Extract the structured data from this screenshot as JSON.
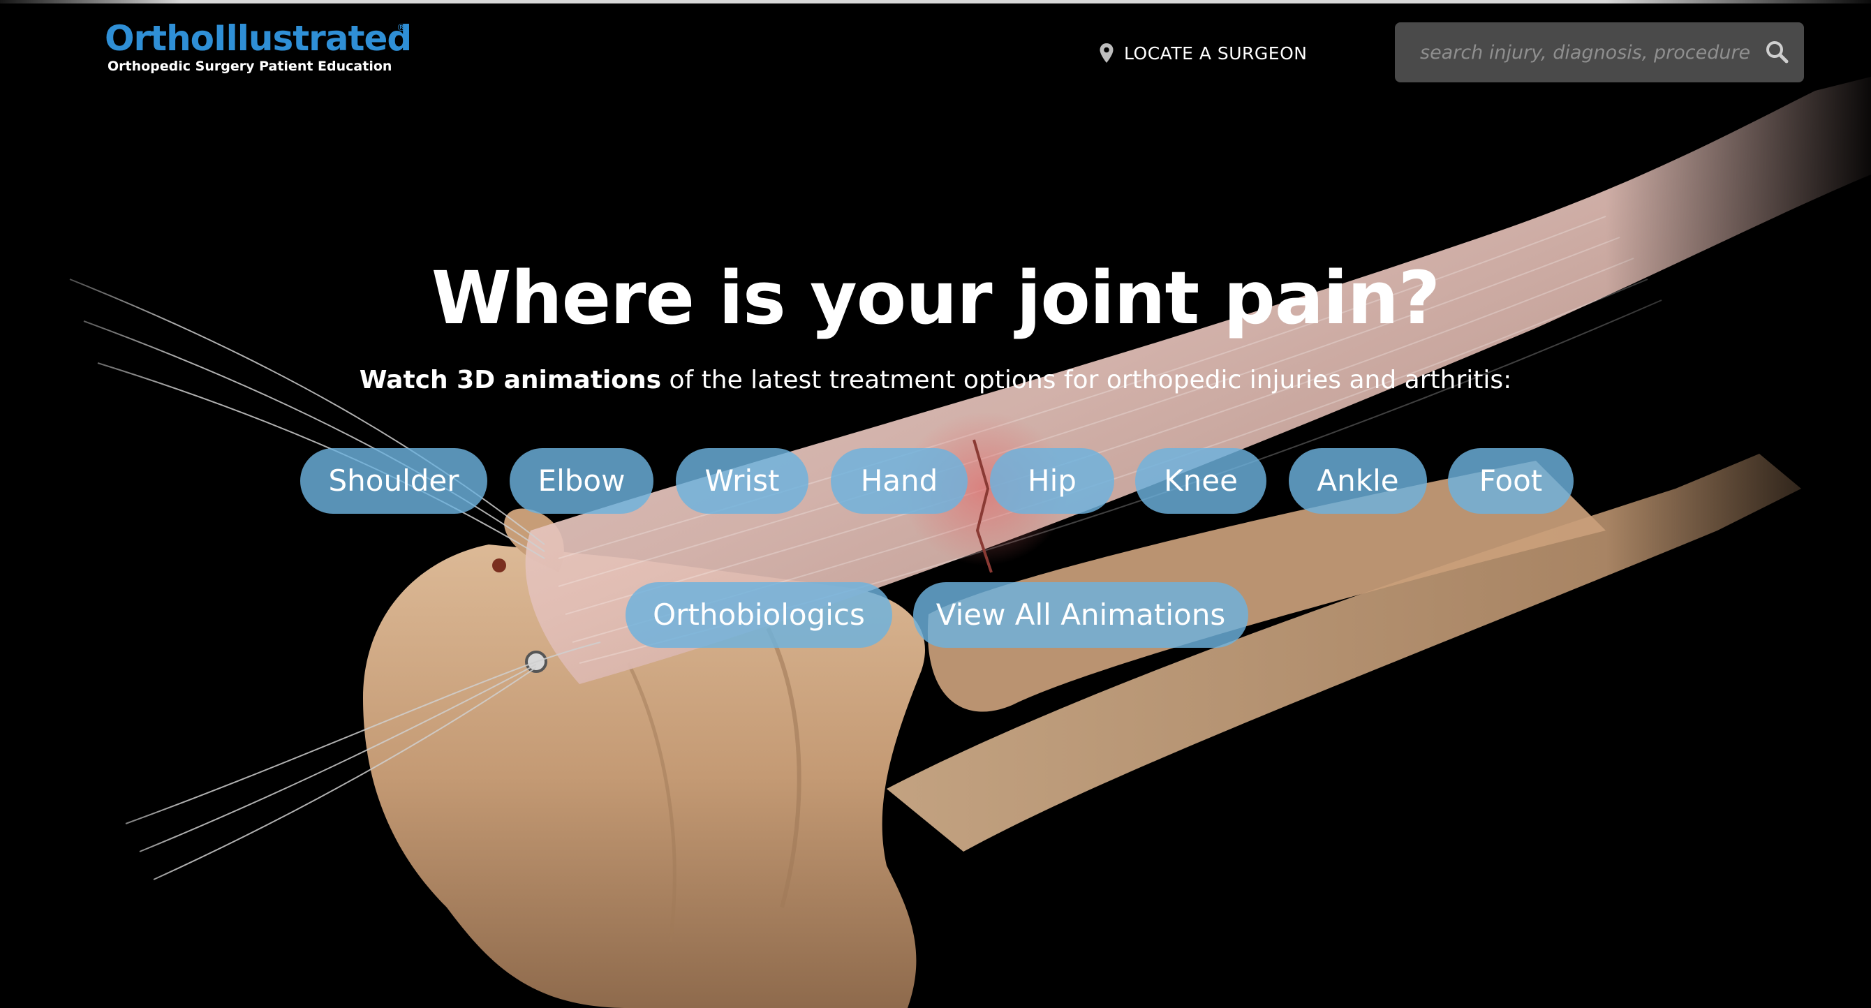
{
  "brand": {
    "name": "OrthoIllustrated",
    "registered": "®",
    "tagline": "Orthopedic Surgery Patient Education",
    "color": "#2f8fd6"
  },
  "nav": {
    "locate_label": "LOCATE A SURGEON",
    "locate_icon": "map-pin-icon"
  },
  "search": {
    "placeholder": "search injury, diagnosis, procedure",
    "icon": "search-icon"
  },
  "hero": {
    "headline": "Where is your joint pain?",
    "sub_bold": "Watch 3D animations",
    "sub_rest": " of the latest treatment options for orthopedic injuries and arthritis:",
    "background": "3D animation still of elbow joint anatomy"
  },
  "joints": [
    {
      "label": "Shoulder"
    },
    {
      "label": "Elbow"
    },
    {
      "label": "Wrist"
    },
    {
      "label": "Hand"
    },
    {
      "label": "Hip"
    },
    {
      "label": "Knee"
    },
    {
      "label": "Ankle"
    },
    {
      "label": "Foot"
    }
  ],
  "extras": [
    {
      "label": "Orthobiologics"
    },
    {
      "label": "View All Animations"
    }
  ],
  "colors": {
    "background": "#000000",
    "pill": "#6cb2de",
    "bone": "#c9a27f",
    "tendon": "#e9cfc9"
  }
}
